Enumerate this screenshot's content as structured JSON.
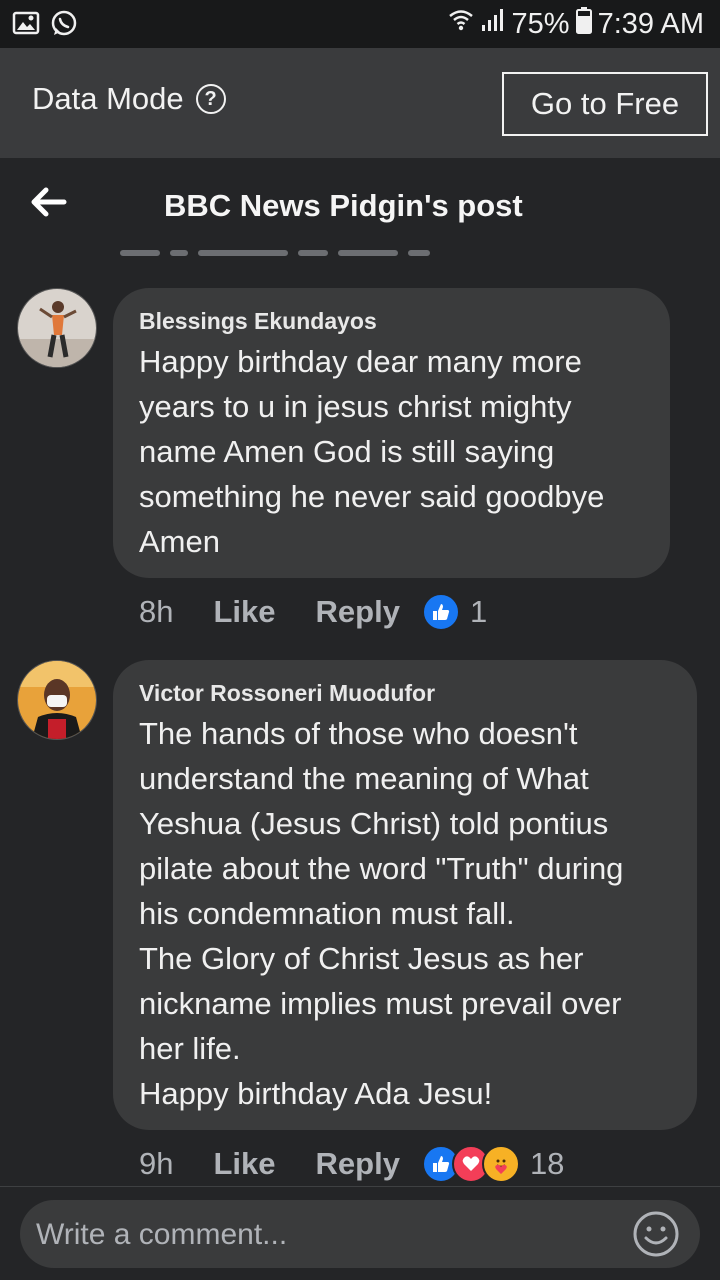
{
  "status_bar": {
    "battery": "75%",
    "time": "7:39 AM"
  },
  "data_mode": {
    "label": "Data Mode",
    "help": "?",
    "go_free_button": "Go to Free"
  },
  "header": {
    "title": "BBC News Pidgin's post"
  },
  "comments": [
    {
      "author": "Blessings Ekundayos",
      "text": "Happy birthday dear many more years to u in jesus christ mighty name Amen God is still saying something he never said goodbye Amen",
      "time": "8h",
      "like": "Like",
      "reply": "Reply",
      "reaction_count": "1"
    },
    {
      "author": "Victor Rossoneri Muodufor",
      "text": "The hands of those who doesn't understand the meaning of What Yeshua (Jesus Christ) told pontius pilate about the word \"Truth\" during his condemnation must fall.\nThe Glory of Christ Jesus as her nickname implies must prevail over her life.\nHappy birthday Ada Jesu!",
      "time": "9h",
      "like": "Like",
      "reply": "Reply",
      "reaction_count": "18"
    }
  ],
  "composer": {
    "placeholder": "Write a comment..."
  },
  "icons": [
    "image-icon",
    "whatsapp-icon",
    "wifi-icon",
    "signal-icon",
    "battery-icon",
    "help-icon",
    "back-arrow-icon",
    "like-reaction-icon",
    "love-reaction-icon",
    "care-reaction-icon",
    "emoji-icon"
  ],
  "colors": {
    "background": "#242527",
    "bubble": "#3a3b3c",
    "like_blue": "#1877f2",
    "love_red": "#f33e58",
    "care_yellow": "#f7b125"
  }
}
